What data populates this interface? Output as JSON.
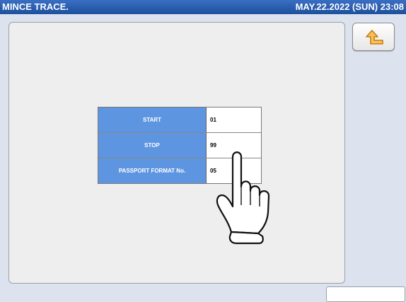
{
  "title_bar": {
    "title": "MINCE TRACE.",
    "datetime": "MAY.22.2022 (SUN)  23:08"
  },
  "return_button": {
    "icon": "return-arrow-icon",
    "accent_color": "#e89a1c"
  },
  "trace_table": {
    "rows": [
      {
        "label": "START",
        "value": "01"
      },
      {
        "label": "STOP",
        "value": "99"
      },
      {
        "label": "PASSPORT FORMAT No.",
        "value": "05"
      }
    ]
  },
  "colors": {
    "title_bar": "#1d4f9c",
    "label_cell": "#5e95e0",
    "background": "#dde3ee"
  }
}
